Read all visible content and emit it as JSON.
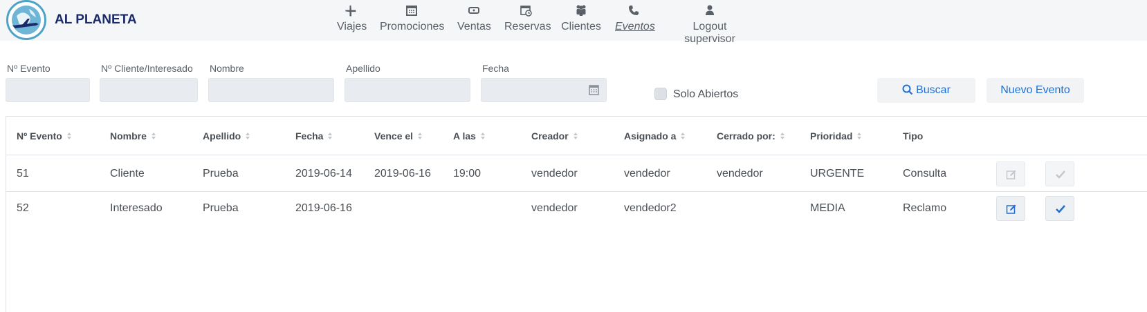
{
  "brand": {
    "name": "AL PLANETA"
  },
  "nav": [
    {
      "label": "Viajes",
      "icon": "plane-icon"
    },
    {
      "label": "Promociones",
      "icon": "calendar-icon"
    },
    {
      "label": "Ventas",
      "icon": "money-icon"
    },
    {
      "label": "Reservas",
      "icon": "calendar-clock-icon"
    },
    {
      "label": "Clientes",
      "icon": "users-icon"
    },
    {
      "label": "Eventos",
      "icon": "phone-icon",
      "active": true
    },
    {
      "label": "Logout supervisor",
      "icon": "user-icon"
    }
  ],
  "filters": {
    "evento": {
      "label": "Nº Evento",
      "value": ""
    },
    "cliente": {
      "label": "Nº Cliente/Interesado",
      "value": ""
    },
    "nombre": {
      "label": "Nombre",
      "value": ""
    },
    "apellido": {
      "label": "Apellido",
      "value": ""
    },
    "fecha": {
      "label": "Fecha",
      "value": ""
    },
    "solo_abiertos": {
      "label": "Solo Abiertos",
      "checked": false
    }
  },
  "buttons": {
    "buscar": "Buscar",
    "nuevo": "Nuevo Evento"
  },
  "table": {
    "headers": [
      "Nº Evento",
      "Nombre",
      "Apellido",
      "Fecha",
      "Vence el",
      "A las",
      "Creador",
      "Asignado a",
      "Cerrado por:",
      "Prioridad",
      "Tipo"
    ],
    "rows": [
      [
        "51",
        "Cliente",
        "Prueba",
        "2019-06-14",
        "2019-06-16",
        "19:00",
        "vendedor",
        "vendedor",
        "vendedor",
        "URGENTE",
        "Consulta"
      ],
      [
        "52",
        "Interesado",
        "Prueba",
        "2019-06-16",
        "",
        "",
        "vendedor",
        "vendedor2",
        "",
        "MEDIA",
        "Reclamo"
      ]
    ]
  },
  "colors": {
    "accent": "#1f6fd6",
    "brand": "#1b2a6b",
    "logo": "#4da3c7"
  }
}
